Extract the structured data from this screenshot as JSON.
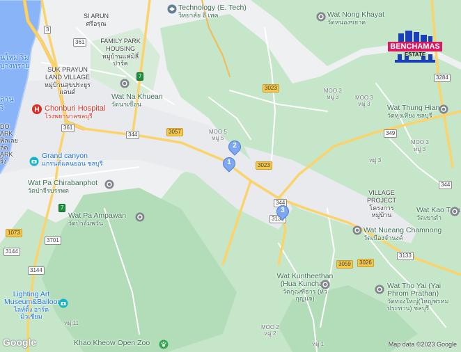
{
  "map": {
    "attribution": "Map data ©2023 Google",
    "google_logo": "Google",
    "colors": {
      "land": "#eef0f1",
      "forest": "#c5e6c9",
      "forest_dark": "#b3dcb9",
      "water": "#8ab4f8",
      "road_major": "#fbd36b",
      "road_minor": "#ffffff",
      "pin": "#7da7f0",
      "hospital": "#d93025",
      "poi": "#3b6e52"
    },
    "places": [
      {
        "name": "SI ARUN",
        "thai": "ศรีอรุณ"
      },
      {
        "name": "FAMILY PARK HOUSING",
        "thai": "หมู่บ้านแฟมิลี่ปาร์ค"
      },
      {
        "name": "SUK PRAYUN LAND VILLAGE",
        "thai": "หมู่บ้านสุขประยูรแลนด์"
      },
      {
        "name": "VILLAGE PROJECT",
        "thai": "โครงการหมู่บ้าน"
      },
      {
        "name": "MOO 5",
        "thai": "หมู่ 5"
      },
      {
        "name": "MOO 3",
        "thai": "หมู่ 3"
      },
      {
        "name": "MOO 3",
        "thai": "หมู่ 3"
      },
      {
        "name": "MOO 2",
        "thai": "หมู่ 2"
      },
      {
        "name": "หมู่ 3",
        "thai": ""
      },
      {
        "name": "หมู่ 11",
        "thai": ""
      },
      {
        "name": "หมู่ 1",
        "thai": ""
      },
      {
        "name": "หมู่ 3",
        "thai": ""
      },
      {
        "name": "MOO 3",
        "thai": ""
      }
    ],
    "pois": [
      {
        "name": "Technology (E. Tech)",
        "thai": "วิทยาลัย อี เทค"
      },
      {
        "name": "Wat Nong Khayat",
        "thai": "วัดหนองขยาด"
      },
      {
        "name": "Wat Na Khuean",
        "thai": "วัดนาเขื่อน"
      },
      {
        "name": "Wat Thung Hiang",
        "thai": "วัดทุ่งเหียง ชลบุรี"
      },
      {
        "name": "Wat Pa Chirabanphot",
        "thai": "วัดป่าจีรบรรพต"
      },
      {
        "name": "Wat Pa Ampawan",
        "thai": "วัดป่าอัมพวัน"
      },
      {
        "name": "Wat Kao Tum",
        "thai": "วัดเขาตํา"
      },
      {
        "name": "Wat Nueang Chamnong",
        "thai": "วัดเนืองจํานงค์"
      },
      {
        "name": "Wat Kuntheethan (Hua Kunchae)",
        "thai": "วัดกุณฑีธาร (หัวกุญแจ)"
      },
      {
        "name": "Wat Tho Yai (Yai Phrom Prathan)",
        "thai": "วัดทองใหญ่(ใหญ่พรหมประทาน) ชลบุรี"
      },
      {
        "name": "Grand canyon",
        "thai": "แกรนด์แคนยอน ชลบุรี"
      },
      {
        "name": "Lighting Art Museum&Balloon",
        "thai": "ไลท์ติ้ง อาร์ต มิวเซียม"
      },
      {
        "name": "Khao Kheow Open Zoo",
        "thai": ""
      }
    ],
    "hospital": {
      "name": "Chonburi Hospital",
      "thai": "โรงพยาบาลชลบุรี"
    },
    "left_edge_text": [
      "นใหม่ ริม",
      "บางทราย",
      "ลาน",
      "ริ",
      "DO",
      "ARK",
      "ฟิลเลย",
      "ล์ค",
      "ARK",
      "ริ่ง"
    ],
    "shields": [
      "3",
      "361",
      "361",
      "344",
      "3057",
      "3023",
      "3023",
      "344",
      "3144",
      "3701",
      "1073",
      "3144",
      "3284",
      "349",
      "3133",
      "3026",
      "3059",
      "3133",
      "344"
    ],
    "shields_green": [
      "7",
      "7"
    ],
    "pins": [
      "1",
      "2",
      "3"
    ]
  },
  "logo": {
    "line1": "BENCHAMAS",
    "line2": "ESTATE"
  }
}
